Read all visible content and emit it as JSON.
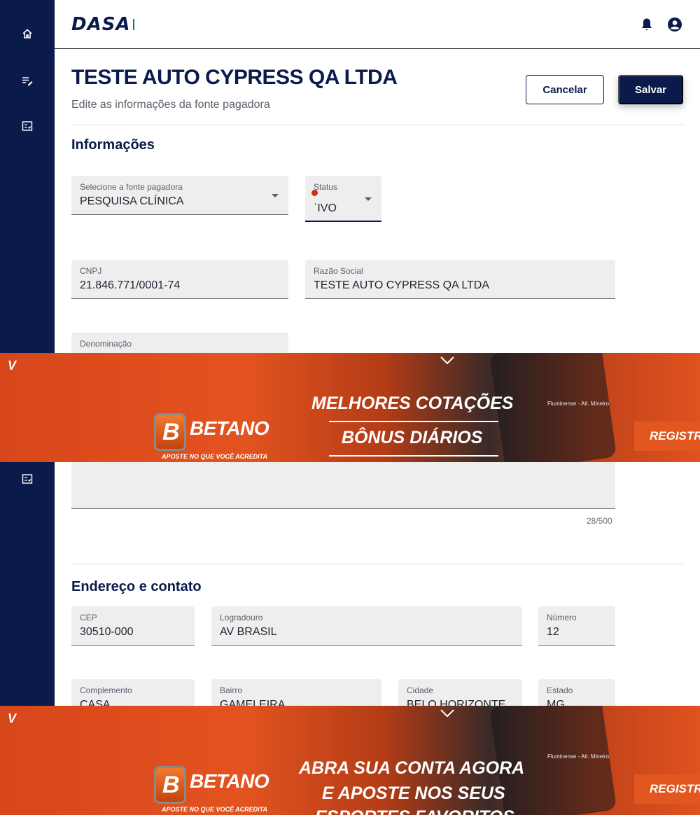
{
  "header": {
    "logo": "DASA",
    "notifications_icon": "bell-icon",
    "profile_icon": "user-circle-icon"
  },
  "sidebar": {
    "items": [
      {
        "icon": "home-icon"
      },
      {
        "icon": "edit-list-icon"
      },
      {
        "icon": "checklist-icon"
      },
      {
        "icon": "checklist-icon"
      }
    ]
  },
  "page": {
    "title": "TESTE AUTO CYPRESS QA LTDA",
    "subtitle": "Edite as informações da fonte pagadora",
    "cancel_label": "Cancelar",
    "save_label": "Salvar"
  },
  "informacoes": {
    "title": "Informações",
    "fonte_pagadora": {
      "label": "Selecione a fonte pagadora",
      "value": "PESQUISA CLÍNICA"
    },
    "status": {
      "label": "Status",
      "value": "ˈIVO"
    },
    "cnpj": {
      "label": "CNPJ",
      "value": "21.846.771/0001-74"
    },
    "razao_social": {
      "label": "Razão Social",
      "value": "TESTE AUTO CYPRESS QA LTDA"
    },
    "denominacao": {
      "label": "Denominação"
    },
    "counter": "28/500"
  },
  "endereco": {
    "title": "Endereço e contato",
    "cep": {
      "label": "CEP",
      "value": "30510-000"
    },
    "logradouro": {
      "label": "Logradouro",
      "value": "AV BRASIL"
    },
    "numero": {
      "label": "Número",
      "value": "12"
    },
    "complemento": {
      "label": "Complemento",
      "value": "CASA"
    },
    "bairro": {
      "label": "Bairro",
      "value": "GAMELEIRA"
    },
    "cidade": {
      "label": "Cidade",
      "value": "BELO HORIZONTE"
    },
    "estado": {
      "label": "Estado",
      "value": "MG"
    }
  },
  "ads": [
    {
      "brand": "BETANO",
      "tagline": "APOSTE NO QUE VOCÊ ACREDITA",
      "line1": "MELHORES COTAÇÕES",
      "line2": "BÔNUS DIÁRIOS",
      "cta": "REGISTR",
      "match": "Fluminense - Atl. Mineiro"
    },
    {
      "brand": "BETANO",
      "tagline": "APOSTE NO QUE VOCÊ ACREDITA",
      "line1": "ABRA SUA CONTA AGORA",
      "line2": "E APOSTE NOS SEUS",
      "line3": "ESPORTES FAVORITOS",
      "cta": "REGISTR",
      "match": "Fluminense - Atl. Mineiro"
    }
  ],
  "colors": {
    "navy": "#0a1a4a",
    "ad_orange": "#e3531f",
    "alert_red": "#d42b16"
  }
}
